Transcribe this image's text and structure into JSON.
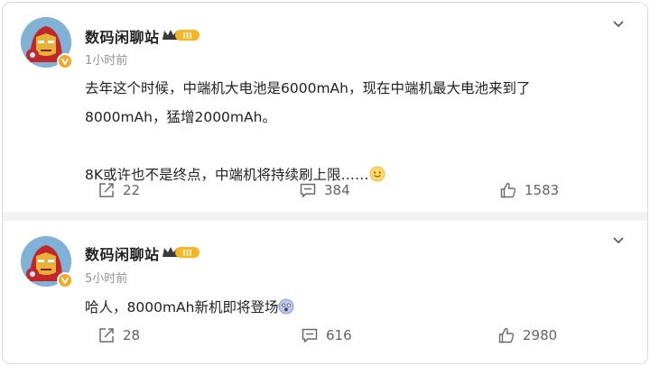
{
  "posts": [
    {
      "author": "数码闲聊站",
      "level_badge": "III",
      "time": "1小时前",
      "content_lines": [
        "去年这个时候，中端机大电池是6000mAh，现在中端机最大电池来到了",
        "8000mAh，猛增2000mAh。",
        "",
        "8K或许也不是终点，中端机将持续刷上限……"
      ],
      "content_emoji": "smile-emoji",
      "reposts": "22",
      "comments": "384",
      "likes": "1583"
    },
    {
      "author": "数码闲聊站",
      "level_badge": "III",
      "time": "5小时前",
      "content_lines": [
        "哈人，8000mAh新机即将登场"
      ],
      "content_emoji": "scared-emoji",
      "reposts": "28",
      "comments": "616",
      "likes": "2980"
    }
  ],
  "icons": {
    "repost": "repost-icon",
    "comment": "comment-icon",
    "like": "like-icon",
    "expand": "chevron-down-icon",
    "verified": "verified-badge-icon"
  },
  "colors": {
    "accent_badge": "#f5a623",
    "text_secondary": "#939393",
    "action_text": "#636363",
    "separator": "#f2f2f2"
  }
}
